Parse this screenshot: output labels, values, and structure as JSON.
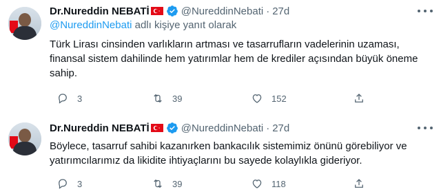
{
  "tweets": [
    {
      "name": "Dr.Nureddin NEBATİ",
      "handle": "@NureddinNebati",
      "separator": "·",
      "time": "27d",
      "reply_to_mention": "@NureddinNebati",
      "reply_to_suffix": " adlı kişiye yanıt olarak",
      "text": "Türk Lirası cinsinden varlıkların artması ve tasarrufların vadelerinin uzaması, finansal sistem dahilinde hem yatırımlar hem de krediler açısından büyük öneme sahip.",
      "replies": "3",
      "retweets": "39",
      "likes": "152"
    },
    {
      "name": "Dr.Nureddin NEBATİ",
      "handle": "@NureddinNebati",
      "separator": "·",
      "time": "27d",
      "text": "Böylece, tasarruf sahibi kazanırken  bankacılık sistemimiz önünü görebiliyor ve yatırımcılarımız da likidite ihtiyaçlarını bu sayede kolaylıkla gideriyor.",
      "replies": "3",
      "retweets": "39",
      "likes": "118"
    }
  ],
  "colors": {
    "text": "#0f1419",
    "secondary": "#536471",
    "link": "#1d9bf0",
    "verified": "#1d9bf0",
    "flag": "#e30a17"
  },
  "icons": [
    "more-icon",
    "verified-icon",
    "turkish-flag-icon",
    "reply-icon",
    "retweet-icon",
    "like-icon",
    "share-icon"
  ]
}
